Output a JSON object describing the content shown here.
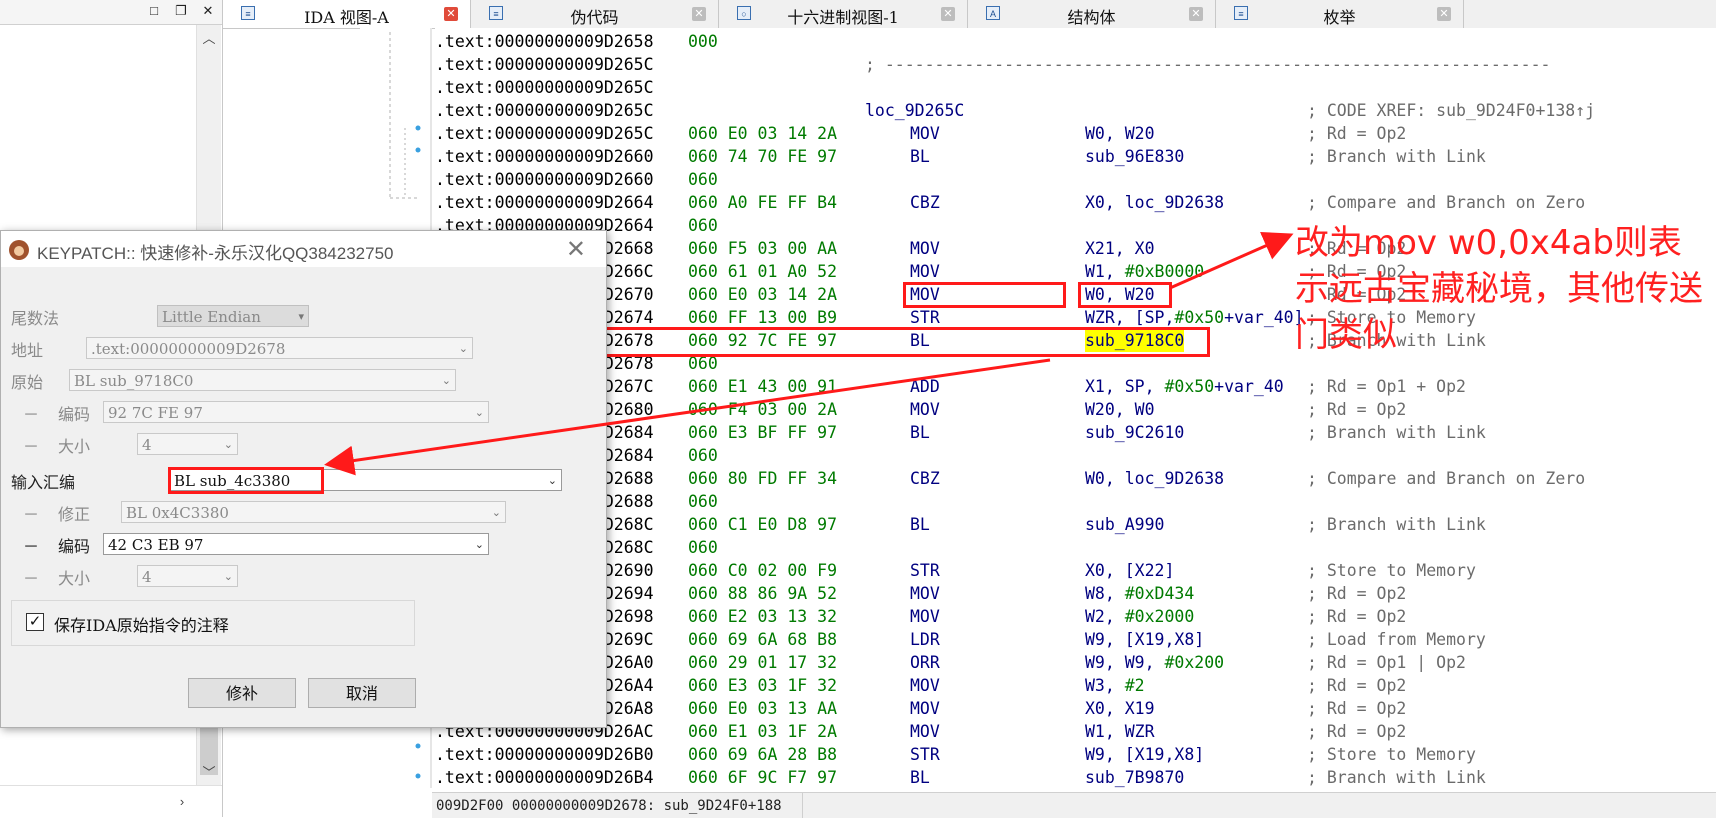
{
  "tabs": [
    {
      "label": "IDA 视图-A",
      "icon": "ida-view-icon",
      "active": true
    },
    {
      "label": "伪代码",
      "icon": "pseudocode-icon",
      "active": false
    },
    {
      "label": "十六进制视图-1",
      "icon": "hex-view-icon",
      "active": false
    },
    {
      "label": "结构体",
      "icon": "structures-icon",
      "active": false
    },
    {
      "label": "枚举",
      "icon": "enums-icon",
      "active": false
    }
  ],
  "left_panel": {
    "buttons": [
      "□",
      "❐",
      "✕"
    ]
  },
  "disasm_rows": [
    {
      "addr": ".text:00000000009D2658",
      "bytes": "000",
      "label": "",
      "mnemonic": "",
      "operand": "",
      "comment": ""
    },
    {
      "addr": ".text:00000000009D265C",
      "bytes": "",
      "label": "",
      "mnemonic": "",
      "operand": "",
      "comment": "; -------------------------------------------------------------------"
    },
    {
      "addr": ".text:00000000009D265C",
      "bytes": "",
      "label": "",
      "mnemonic": "",
      "operand": "",
      "comment": ""
    },
    {
      "addr": ".text:00000000009D265C",
      "bytes": "",
      "label": "loc_9D265C",
      "mnemonic": "",
      "operand": "",
      "comment": "; CODE XREF: sub_9D24F0+138↑j"
    },
    {
      "addr": ".text:00000000009D265C",
      "bytes": "060 E0 03 14 2A",
      "label": "",
      "mnemonic": "MOV",
      "operand": "W0, W20",
      "comment": "; Rd = Op2"
    },
    {
      "addr": ".text:00000000009D2660",
      "bytes": "060 74 70 FE 97",
      "label": "",
      "mnemonic": "BL",
      "operand": "sub_96E830",
      "comment": "; Branch with Link"
    },
    {
      "addr": ".text:00000000009D2660",
      "bytes": "060",
      "label": "",
      "mnemonic": "",
      "operand": "",
      "comment": ""
    },
    {
      "addr": ".text:00000000009D2664",
      "bytes": "060 A0 FE FF B4",
      "label": "",
      "mnemonic": "CBZ",
      "operand": "X0, loc_9D2638",
      "comment": "; Compare and Branch on Zero"
    },
    {
      "addr": ".text:00000000009D2664",
      "bytes": "060",
      "label": "",
      "mnemonic": "",
      "operand": "",
      "comment": ""
    },
    {
      "addr": ".text:00000000009D2668",
      "bytes": "060 F5 03 00 AA",
      "label": "",
      "mnemonic": "MOV",
      "operand": "X21, X0",
      "comment": "; Rd = Op2"
    },
    {
      "addr": ".text:00000000009D266C",
      "bytes": "060 61 01 A0 52",
      "label": "",
      "mnemonic": "MOV",
      "operand": "W1, #0xB0000",
      "comment": "; Rd = Op2"
    },
    {
      "addr": ".text:00000000009D2670",
      "bytes": "060 E0 03 14 2A",
      "label": "",
      "mnemonic": "MOV",
      "operand": "W0, W20",
      "comment": "; Rd = Op2"
    },
    {
      "addr": ".text:00000000009D2674",
      "bytes": "060 FF 13 00 B9",
      "label": "",
      "mnemonic": "STR",
      "operand": "WZR, [SP,#0x50+var_40]",
      "comment": "; Store to Memory"
    },
    {
      "addr": ".text:00000000009D2678",
      "bytes": "060 92 7C FE 97",
      "label": "",
      "mnemonic": "BL",
      "operand": "sub_9718C0",
      "comment": "; Branch with Link",
      "highlight": true
    },
    {
      "addr": ".text:00000000009D2678",
      "bytes": "060",
      "label": "",
      "mnemonic": "",
      "operand": "",
      "comment": ""
    },
    {
      "addr": ".text:00000000009D267C",
      "bytes": "060 E1 43 00 91",
      "label": "",
      "mnemonic": "ADD",
      "operand": "X1, SP, #0x50+var_40",
      "comment": "; Rd = Op1 + Op2"
    },
    {
      "addr": ".text:00000000009D2680",
      "bytes": "060 F4 03 00 2A",
      "label": "",
      "mnemonic": "MOV",
      "operand": "W20, W0",
      "comment": "; Rd = Op2"
    },
    {
      "addr": ".text:00000000009D2684",
      "bytes": "060 E3 BF FF 97",
      "label": "",
      "mnemonic": "BL",
      "operand": "sub_9C2610",
      "comment": "; Branch with Link"
    },
    {
      "addr": ".text:00000000009D2684",
      "bytes": "060",
      "label": "",
      "mnemonic": "",
      "operand": "",
      "comment": ""
    },
    {
      "addr": ".text:00000000009D2688",
      "bytes": "060 80 FD FF 34",
      "label": "",
      "mnemonic": "CBZ",
      "operand": "W0, loc_9D2638",
      "comment": "; Compare and Branch on Zero"
    },
    {
      "addr": ".text:00000000009D2688",
      "bytes": "060",
      "label": "",
      "mnemonic": "",
      "operand": "",
      "comment": ""
    },
    {
      "addr": ".text:00000000009D268C",
      "bytes": "060 C1 E0 D8 97",
      "label": "",
      "mnemonic": "BL",
      "operand": "sub_A990",
      "comment": "; Branch with Link"
    },
    {
      "addr": ".text:00000000009D268C",
      "bytes": "060",
      "label": "",
      "mnemonic": "",
      "operand": "",
      "comment": ""
    },
    {
      "addr": ".text:00000000009D2690",
      "bytes": "060 C0 02 00 F9",
      "label": "",
      "mnemonic": "STR",
      "operand": "X0, [X22]",
      "comment": "; Store to Memory"
    },
    {
      "addr": ".text:00000000009D2694",
      "bytes": "060 88 86 9A 52",
      "label": "",
      "mnemonic": "MOV",
      "operand": "W8, #0xD434",
      "comment": "; Rd = Op2"
    },
    {
      "addr": ".text:00000000009D2698",
      "bytes": "060 E2 03 13 32",
      "label": "",
      "mnemonic": "MOV",
      "operand": "W2, #0x2000",
      "comment": "; Rd = Op2"
    },
    {
      "addr": ".text:00000000009D269C",
      "bytes": "060 69 6A 68 B8",
      "label": "",
      "mnemonic": "LDR",
      "operand": "W9, [X19,X8]",
      "comment": "; Load from Memory"
    },
    {
      "addr": ".text:00000000009D26A0",
      "bytes": "060 29 01 17 32",
      "label": "",
      "mnemonic": "ORR",
      "operand": "W9, W9, #0x200",
      "comment": "; Rd = Op1 | Op2"
    },
    {
      "addr": ".text:00000000009D26A4",
      "bytes": "060 E3 03 1F 32",
      "label": "",
      "mnemonic": "MOV",
      "operand": "W3, #2",
      "comment": "; Rd = Op2"
    },
    {
      "addr": ".text:00000000009D26A8",
      "bytes": "060 E0 03 13 AA",
      "label": "",
      "mnemonic": "MOV",
      "operand": "X0, X19",
      "comment": "; Rd = Op2"
    },
    {
      "addr": ".text:00000000009D26AC",
      "bytes": "060 E1 03 1F 2A",
      "label": "",
      "mnemonic": "MOV",
      "operand": "W1, WZR",
      "comment": "; Rd = Op2"
    },
    {
      "addr": ".text:00000000009D26B0",
      "bytes": "060 69 6A 28 B8",
      "label": "",
      "mnemonic": "STR",
      "operand": "W9, [X19,X8]",
      "comment": "; Store to Memory"
    },
    {
      "addr": ".text:00000000009D26B4",
      "bytes": "060 6F 9C F7 97",
      "label": "",
      "mnemonic": "BL",
      "operand": "sub_7B9870",
      "comment": "; Branch with Link"
    }
  ],
  "status_bar": {
    "text": "009D2F00 00000000009D2678: sub_9D24F0+188"
  },
  "dialog": {
    "title": "KEYPATCH:: 快速修补-永乐汉化QQ384232750",
    "endian_label": "尾数法",
    "endian_value": "Little Endian",
    "address_label": "地址",
    "address_value": ".text:00000000009D2678",
    "original_label": "原始",
    "original_value": "BL sub_9718C0",
    "orig_encoding_label": "编码",
    "orig_encoding_value": "92 7C FE 97",
    "orig_size_label": "大小",
    "orig_size_value": "4",
    "input_asm_label": "输入汇编",
    "input_asm_value": "BL sub_4c3380",
    "fixup_label": "修正",
    "fixup_value": "BL 0x4C3380",
    "new_encoding_label": "编码",
    "new_encoding_value": "42 C3 EB 97",
    "new_size_label": "大小",
    "new_size_value": "4",
    "dash": "－",
    "keep_comment_label": "保存IDA原始指令的注释",
    "keep_comment_checked": true,
    "patch_button": "修补",
    "cancel_button": "取消"
  },
  "annotation": {
    "text": "改为mov w0,0x4ab则表示远古宝藏秘境，其他传送门类似",
    "color": "#ff2020"
  }
}
